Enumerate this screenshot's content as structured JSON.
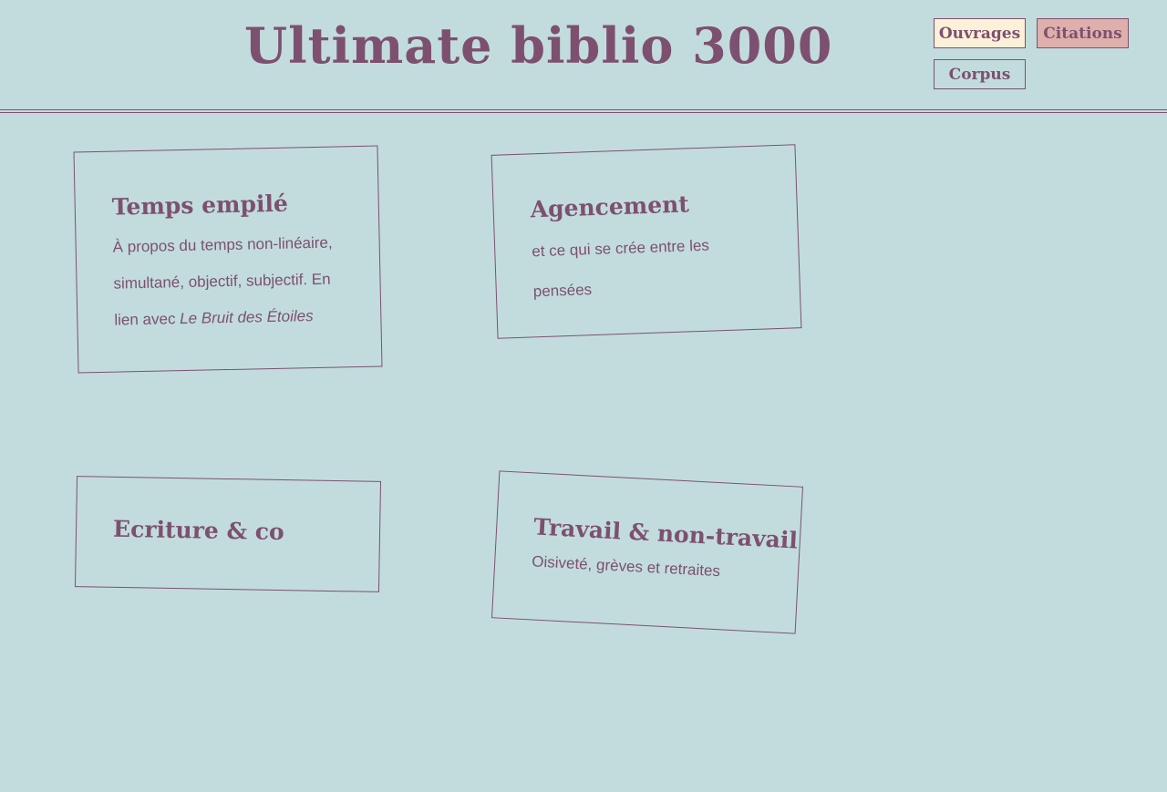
{
  "header": {
    "title": "Ultimate biblio 3000",
    "nav": {
      "ouvrages": "Ouvrages",
      "citations": "Citations",
      "corpus": "Corpus"
    }
  },
  "colors": {
    "background": "#c2dcdd",
    "accent": "#7d5070",
    "ouvrages_bg": "#fdf0d8",
    "citations_bg": "#dfb0ab"
  },
  "cards": [
    {
      "title": "Temps empilé",
      "desc_before": "À propos du temps non-linéaire, simultané, objectif, subjectif. En lien avec ",
      "desc_italic": "Le Bruit des Étoiles"
    },
    {
      "title": "Agencement",
      "desc": "et ce qui se crée entre les pensées"
    },
    {
      "title": "Ecriture & co"
    },
    {
      "title": "Travail & non-travail",
      "desc": "Oisiveté, grèves et retraites"
    }
  ]
}
